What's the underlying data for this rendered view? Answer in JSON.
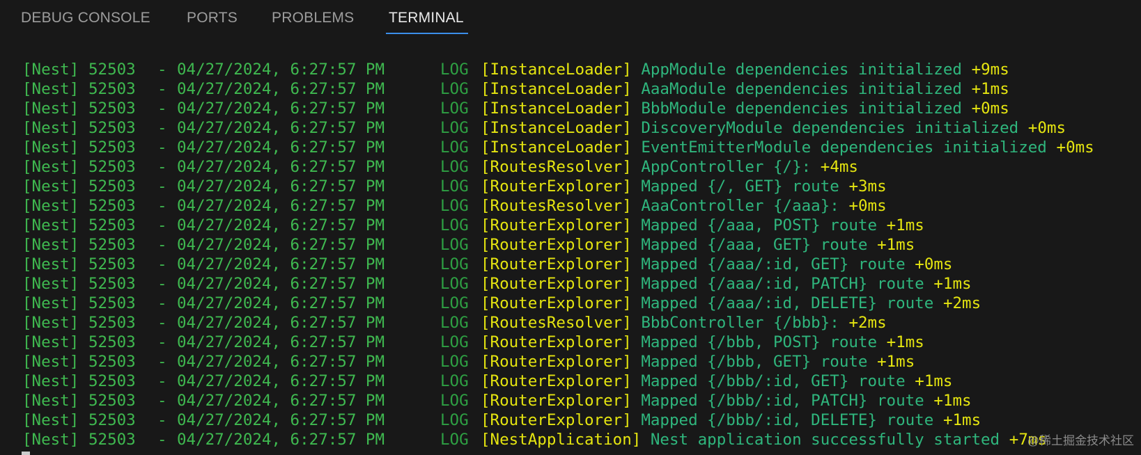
{
  "tabs": {
    "debug_console": "DEBUG CONSOLE",
    "ports": "PORTS",
    "problems": "PROBLEMS",
    "terminal": "TERMINAL",
    "active": "terminal"
  },
  "terminal": {
    "lines": [
      {
        "prefix": "[Nest]",
        "pid": "52503",
        "sep": "-",
        "ts": "04/27/2024, 6:27:57 PM",
        "level": "LOG",
        "ctx": "[InstanceLoader]",
        "msg": "AppModule dependencies initialized",
        "time": "+9ms"
      },
      {
        "prefix": "[Nest]",
        "pid": "52503",
        "sep": "-",
        "ts": "04/27/2024, 6:27:57 PM",
        "level": "LOG",
        "ctx": "[InstanceLoader]",
        "msg": "AaaModule dependencies initialized",
        "time": "+1ms"
      },
      {
        "prefix": "[Nest]",
        "pid": "52503",
        "sep": "-",
        "ts": "04/27/2024, 6:27:57 PM",
        "level": "LOG",
        "ctx": "[InstanceLoader]",
        "msg": "BbbModule dependencies initialized",
        "time": "+0ms"
      },
      {
        "prefix": "[Nest]",
        "pid": "52503",
        "sep": "-",
        "ts": "04/27/2024, 6:27:57 PM",
        "level": "LOG",
        "ctx": "[InstanceLoader]",
        "msg": "DiscoveryModule dependencies initialized",
        "time": "+0ms"
      },
      {
        "prefix": "[Nest]",
        "pid": "52503",
        "sep": "-",
        "ts": "04/27/2024, 6:27:57 PM",
        "level": "LOG",
        "ctx": "[InstanceLoader]",
        "msg": "EventEmitterModule dependencies initialized",
        "time": "+0ms"
      },
      {
        "prefix": "[Nest]",
        "pid": "52503",
        "sep": "-",
        "ts": "04/27/2024, 6:27:57 PM",
        "level": "LOG",
        "ctx": "[RoutesResolver]",
        "msg": "AppController {/}:",
        "time": "+4ms"
      },
      {
        "prefix": "[Nest]",
        "pid": "52503",
        "sep": "-",
        "ts": "04/27/2024, 6:27:57 PM",
        "level": "LOG",
        "ctx": "[RouterExplorer]",
        "msg": "Mapped {/, GET} route",
        "time": "+3ms"
      },
      {
        "prefix": "[Nest]",
        "pid": "52503",
        "sep": "-",
        "ts": "04/27/2024, 6:27:57 PM",
        "level": "LOG",
        "ctx": "[RoutesResolver]",
        "msg": "AaaController {/aaa}:",
        "time": "+0ms"
      },
      {
        "prefix": "[Nest]",
        "pid": "52503",
        "sep": "-",
        "ts": "04/27/2024, 6:27:57 PM",
        "level": "LOG",
        "ctx": "[RouterExplorer]",
        "msg": "Mapped {/aaa, POST} route",
        "time": "+1ms"
      },
      {
        "prefix": "[Nest]",
        "pid": "52503",
        "sep": "-",
        "ts": "04/27/2024, 6:27:57 PM",
        "level": "LOG",
        "ctx": "[RouterExplorer]",
        "msg": "Mapped {/aaa, GET} route",
        "time": "+1ms"
      },
      {
        "prefix": "[Nest]",
        "pid": "52503",
        "sep": "-",
        "ts": "04/27/2024, 6:27:57 PM",
        "level": "LOG",
        "ctx": "[RouterExplorer]",
        "msg": "Mapped {/aaa/:id, GET} route",
        "time": "+0ms"
      },
      {
        "prefix": "[Nest]",
        "pid": "52503",
        "sep": "-",
        "ts": "04/27/2024, 6:27:57 PM",
        "level": "LOG",
        "ctx": "[RouterExplorer]",
        "msg": "Mapped {/aaa/:id, PATCH} route",
        "time": "+1ms"
      },
      {
        "prefix": "[Nest]",
        "pid": "52503",
        "sep": "-",
        "ts": "04/27/2024, 6:27:57 PM",
        "level": "LOG",
        "ctx": "[RouterExplorer]",
        "msg": "Mapped {/aaa/:id, DELETE} route",
        "time": "+2ms"
      },
      {
        "prefix": "[Nest]",
        "pid": "52503",
        "sep": "-",
        "ts": "04/27/2024, 6:27:57 PM",
        "level": "LOG",
        "ctx": "[RoutesResolver]",
        "msg": "BbbController {/bbb}:",
        "time": "+2ms"
      },
      {
        "prefix": "[Nest]",
        "pid": "52503",
        "sep": "-",
        "ts": "04/27/2024, 6:27:57 PM",
        "level": "LOG",
        "ctx": "[RouterExplorer]",
        "msg": "Mapped {/bbb, POST} route",
        "time": "+1ms"
      },
      {
        "prefix": "[Nest]",
        "pid": "52503",
        "sep": "-",
        "ts": "04/27/2024, 6:27:57 PM",
        "level": "LOG",
        "ctx": "[RouterExplorer]",
        "msg": "Mapped {/bbb, GET} route",
        "time": "+1ms"
      },
      {
        "prefix": "[Nest]",
        "pid": "52503",
        "sep": "-",
        "ts": "04/27/2024, 6:27:57 PM",
        "level": "LOG",
        "ctx": "[RouterExplorer]",
        "msg": "Mapped {/bbb/:id, GET} route",
        "time": "+1ms"
      },
      {
        "prefix": "[Nest]",
        "pid": "52503",
        "sep": "-",
        "ts": "04/27/2024, 6:27:57 PM",
        "level": "LOG",
        "ctx": "[RouterExplorer]",
        "msg": "Mapped {/bbb/:id, PATCH} route",
        "time": "+1ms"
      },
      {
        "prefix": "[Nest]",
        "pid": "52503",
        "sep": "-",
        "ts": "04/27/2024, 6:27:57 PM",
        "level": "LOG",
        "ctx": "[RouterExplorer]",
        "msg": "Mapped {/bbb/:id, DELETE} route",
        "time": "+1ms"
      },
      {
        "prefix": "[Nest]",
        "pid": "52503",
        "sep": "-",
        "ts": "04/27/2024, 6:27:57 PM",
        "level": "LOG",
        "ctx": "[NestApplication]",
        "msg": "Nest application successfully started",
        "time": "+7ms"
      }
    ]
  },
  "watermark": "@稀土掘金技术社区",
  "colors": {
    "background": "#181818",
    "prefix_green": "#3fb950",
    "context_yellow": "#e5e510",
    "message_green": "#2fb67d",
    "tab_active_underline": "#3b8eea"
  }
}
